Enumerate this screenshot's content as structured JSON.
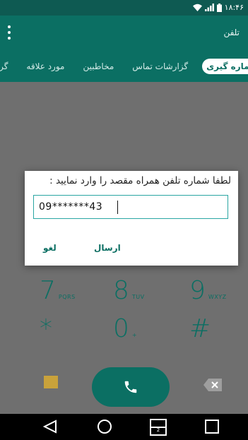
{
  "status_bar": {
    "time": "۱۸:۴۶"
  },
  "app_bar": {
    "title": "تلفن"
  },
  "tabs": [
    {
      "label": "شماره گیری",
      "active": true
    },
    {
      "label": "گزارشات تماس",
      "active": false
    },
    {
      "label": "مخاطبین",
      "active": false
    },
    {
      "label": "مورد علاقه",
      "active": false
    },
    {
      "label": "گروه ها",
      "active": false
    }
  ],
  "dialog": {
    "prompt": "لطفا شماره تلفن همراه مقصد را وارد نمایید :",
    "input_value": "09*******43",
    "send_label": "ارسال",
    "cancel_label": "لغو"
  },
  "dialpad": {
    "keys": [
      {
        "digit": "7",
        "letters": "PQRS"
      },
      {
        "digit": "8",
        "letters": "TUV"
      },
      {
        "digit": "9",
        "letters": "WXYZ"
      },
      {
        "digit": "*",
        "letters": ""
      },
      {
        "digit": "0",
        "letters": "+"
      },
      {
        "digit": "#",
        "letters": ""
      }
    ]
  },
  "nav": {
    "split_label": "2"
  },
  "colors": {
    "primary": "#0b6f63",
    "status_bar": "#0e5a52",
    "scrim": "#6f6f6f",
    "accent_input": "#2aa6a3"
  },
  "icons": [
    "wifi-icon",
    "signal-icon",
    "battery-icon",
    "overflow-menu-icon",
    "message-icon",
    "call-icon",
    "backspace-icon",
    "nav-back-icon",
    "nav-home-icon",
    "nav-dual-window-icon",
    "nav-recents-icon"
  ]
}
